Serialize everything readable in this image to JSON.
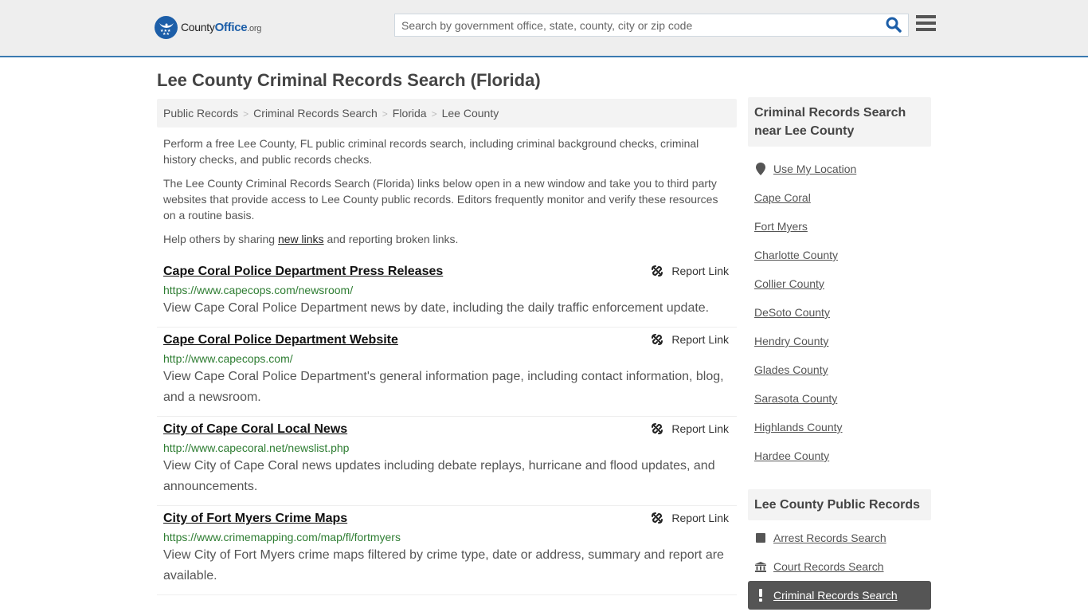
{
  "header": {
    "logo": {
      "text_main": "County",
      "text_brand": "Office",
      "text_tld": ".org"
    },
    "search": {
      "placeholder": "Search by government office, state, county, city or zip code",
      "value": ""
    },
    "icons": {
      "search": "search-icon",
      "menu": "hamburger-menu-icon"
    }
  },
  "page": {
    "title": "Lee County Criminal Records Search (Florida)"
  },
  "breadcrumb": [
    {
      "label": "Public Records"
    },
    {
      "label": "Criminal Records Search"
    },
    {
      "label": "Florida"
    },
    {
      "label": "Lee County"
    }
  ],
  "breadcrumb_separator": ">",
  "intro": {
    "p1": "Perform a free Lee County, FL public criminal records search, including criminal background checks, criminal history checks, and public records checks.",
    "p2": "The Lee County Criminal Records Search (Florida) links below open in a new window and take you to third party websites that provide access to Lee County public records. Editors frequently monitor and verify these resources on a routine basis.",
    "p3_before": "Help others by sharing ",
    "p3_link": "new links",
    "p3_after": " and reporting broken links."
  },
  "results": [
    {
      "title": "Cape Coral Police Department Press Releases",
      "url": "https://www.capecops.com/newsroom/",
      "description": "View Cape Coral Police Department news by date, including the daily traffic enforcement update.",
      "report_label": "Report Link"
    },
    {
      "title": "Cape Coral Police Department Website",
      "url": "http://www.capecops.com/",
      "description": "View Cape Coral Police Department's general information page, including contact information, blog, and a newsroom.",
      "report_label": "Report Link"
    },
    {
      "title": "City of Cape Coral Local News",
      "url": "http://www.capecoral.net/newslist.php",
      "description": "View City of Cape Coral news updates including debate replays, hurricane and flood updates, and announcements.",
      "report_label": "Report Link"
    },
    {
      "title": "City of Fort Myers Crime Maps",
      "url": "https://www.crimemapping.com/map/fl/fortmyers",
      "description": "View City of Fort Myers crime maps filtered by crime type, date or address, summary and report are available.",
      "report_label": "Report Link"
    }
  ],
  "sidebar": {
    "nearby_heading": "Criminal Records Search near Lee County",
    "use_location": "Use My Location",
    "nearby": [
      {
        "label": "Cape Coral"
      },
      {
        "label": "Fort Myers"
      },
      {
        "label": "Charlotte County"
      },
      {
        "label": "Collier County"
      },
      {
        "label": "DeSoto County"
      },
      {
        "label": "Hendry County"
      },
      {
        "label": "Glades County"
      },
      {
        "label": "Sarasota County"
      },
      {
        "label": "Highlands County"
      },
      {
        "label": "Hardee County"
      }
    ],
    "records_heading": "Lee County Public Records",
    "records": [
      {
        "label": "Arrest Records Search",
        "icon": "square-icon",
        "active": false
      },
      {
        "label": "Court Records Search",
        "icon": "courthouse-icon",
        "active": false
      },
      {
        "label": "Criminal Records Search",
        "icon": "exclamation-icon",
        "active": true
      }
    ]
  },
  "colors": {
    "header_bg": "#eeeeee",
    "header_border": "#3a7ab0",
    "brand_blue": "#1c5ea8",
    "url_green": "#2e7d32",
    "active_item_bg": "#555555"
  }
}
